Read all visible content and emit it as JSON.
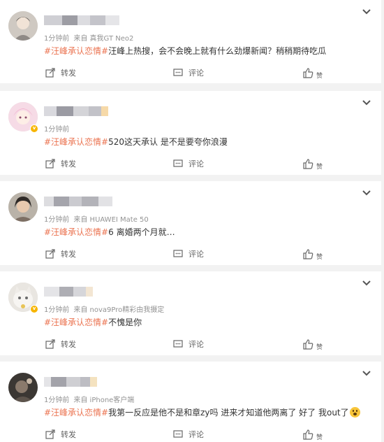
{
  "actions": {
    "share": "转发",
    "comment": "评论",
    "like": "赞"
  },
  "colors": {
    "topic": "#eb7350",
    "meta": "#939393",
    "badge": "#f7b500"
  },
  "posts": [
    {
      "time": "1分钟前",
      "source": "来自 真我GT Neo2",
      "topic": "#汪峰承认恋情#",
      "text": "汪峰上热搜，会不会晚上就有什么劲爆新闻？稍稍期待吃瓜",
      "verified": false
    },
    {
      "time": "1分钟前",
      "source": "",
      "topic": "#汪峰承认恋情#",
      "text": "520这天承认 是不是要夸你浪漫",
      "verified": true
    },
    {
      "time": "1分钟前",
      "source": "来自 HUAWEI Mate 50",
      "topic": "#汪峰承认恋情#",
      "text": "6 离婚两个月就…",
      "verified": false
    },
    {
      "time": "1分钟前",
      "source": "来自 nova9Pro精彩由我摄定",
      "topic": "#汪峰承认恋情#",
      "text": "不愧是你",
      "verified": true
    },
    {
      "time": "1分钟前",
      "source": "来自 iPhone客户端",
      "topic": "#汪峰承认恋情#",
      "text": "我第一反应是他不是和章zy吗 进来才知道他两离了 好了 我out了",
      "verified": false,
      "emoji": "scream-emoji"
    }
  ]
}
